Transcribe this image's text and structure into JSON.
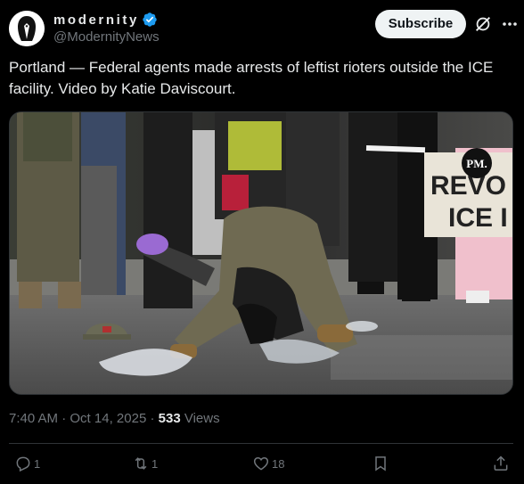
{
  "author": {
    "display_name": "modernity",
    "handle": "@ModernityNews",
    "verified": true,
    "avatar_icon": "penguin-suit-avatar"
  },
  "header": {
    "subscribe_label": "Subscribe",
    "grok_icon": "grok-icon",
    "more_icon": "more-icon"
  },
  "post": {
    "text": "Portland — Federal agents made arrests of leftist rioters outside the ICE facility. Video by Katie Daviscourt.",
    "media": {
      "watermark": "PM.",
      "banner_text_line1": "REVO",
      "banner_text_line2": "ICE I"
    }
  },
  "meta": {
    "time": "7:40 AM",
    "date": "Oct 14, 2025",
    "separator": "·",
    "views_count": "533",
    "views_label": "Views"
  },
  "actions": {
    "replies": "1",
    "reposts": "1",
    "likes": "18"
  },
  "colors": {
    "background": "#000000",
    "text_primary": "#e7e9ea",
    "text_secondary": "#71767b",
    "verified_blue": "#1d9bf0",
    "subscribe_bg": "#eff3f4"
  }
}
